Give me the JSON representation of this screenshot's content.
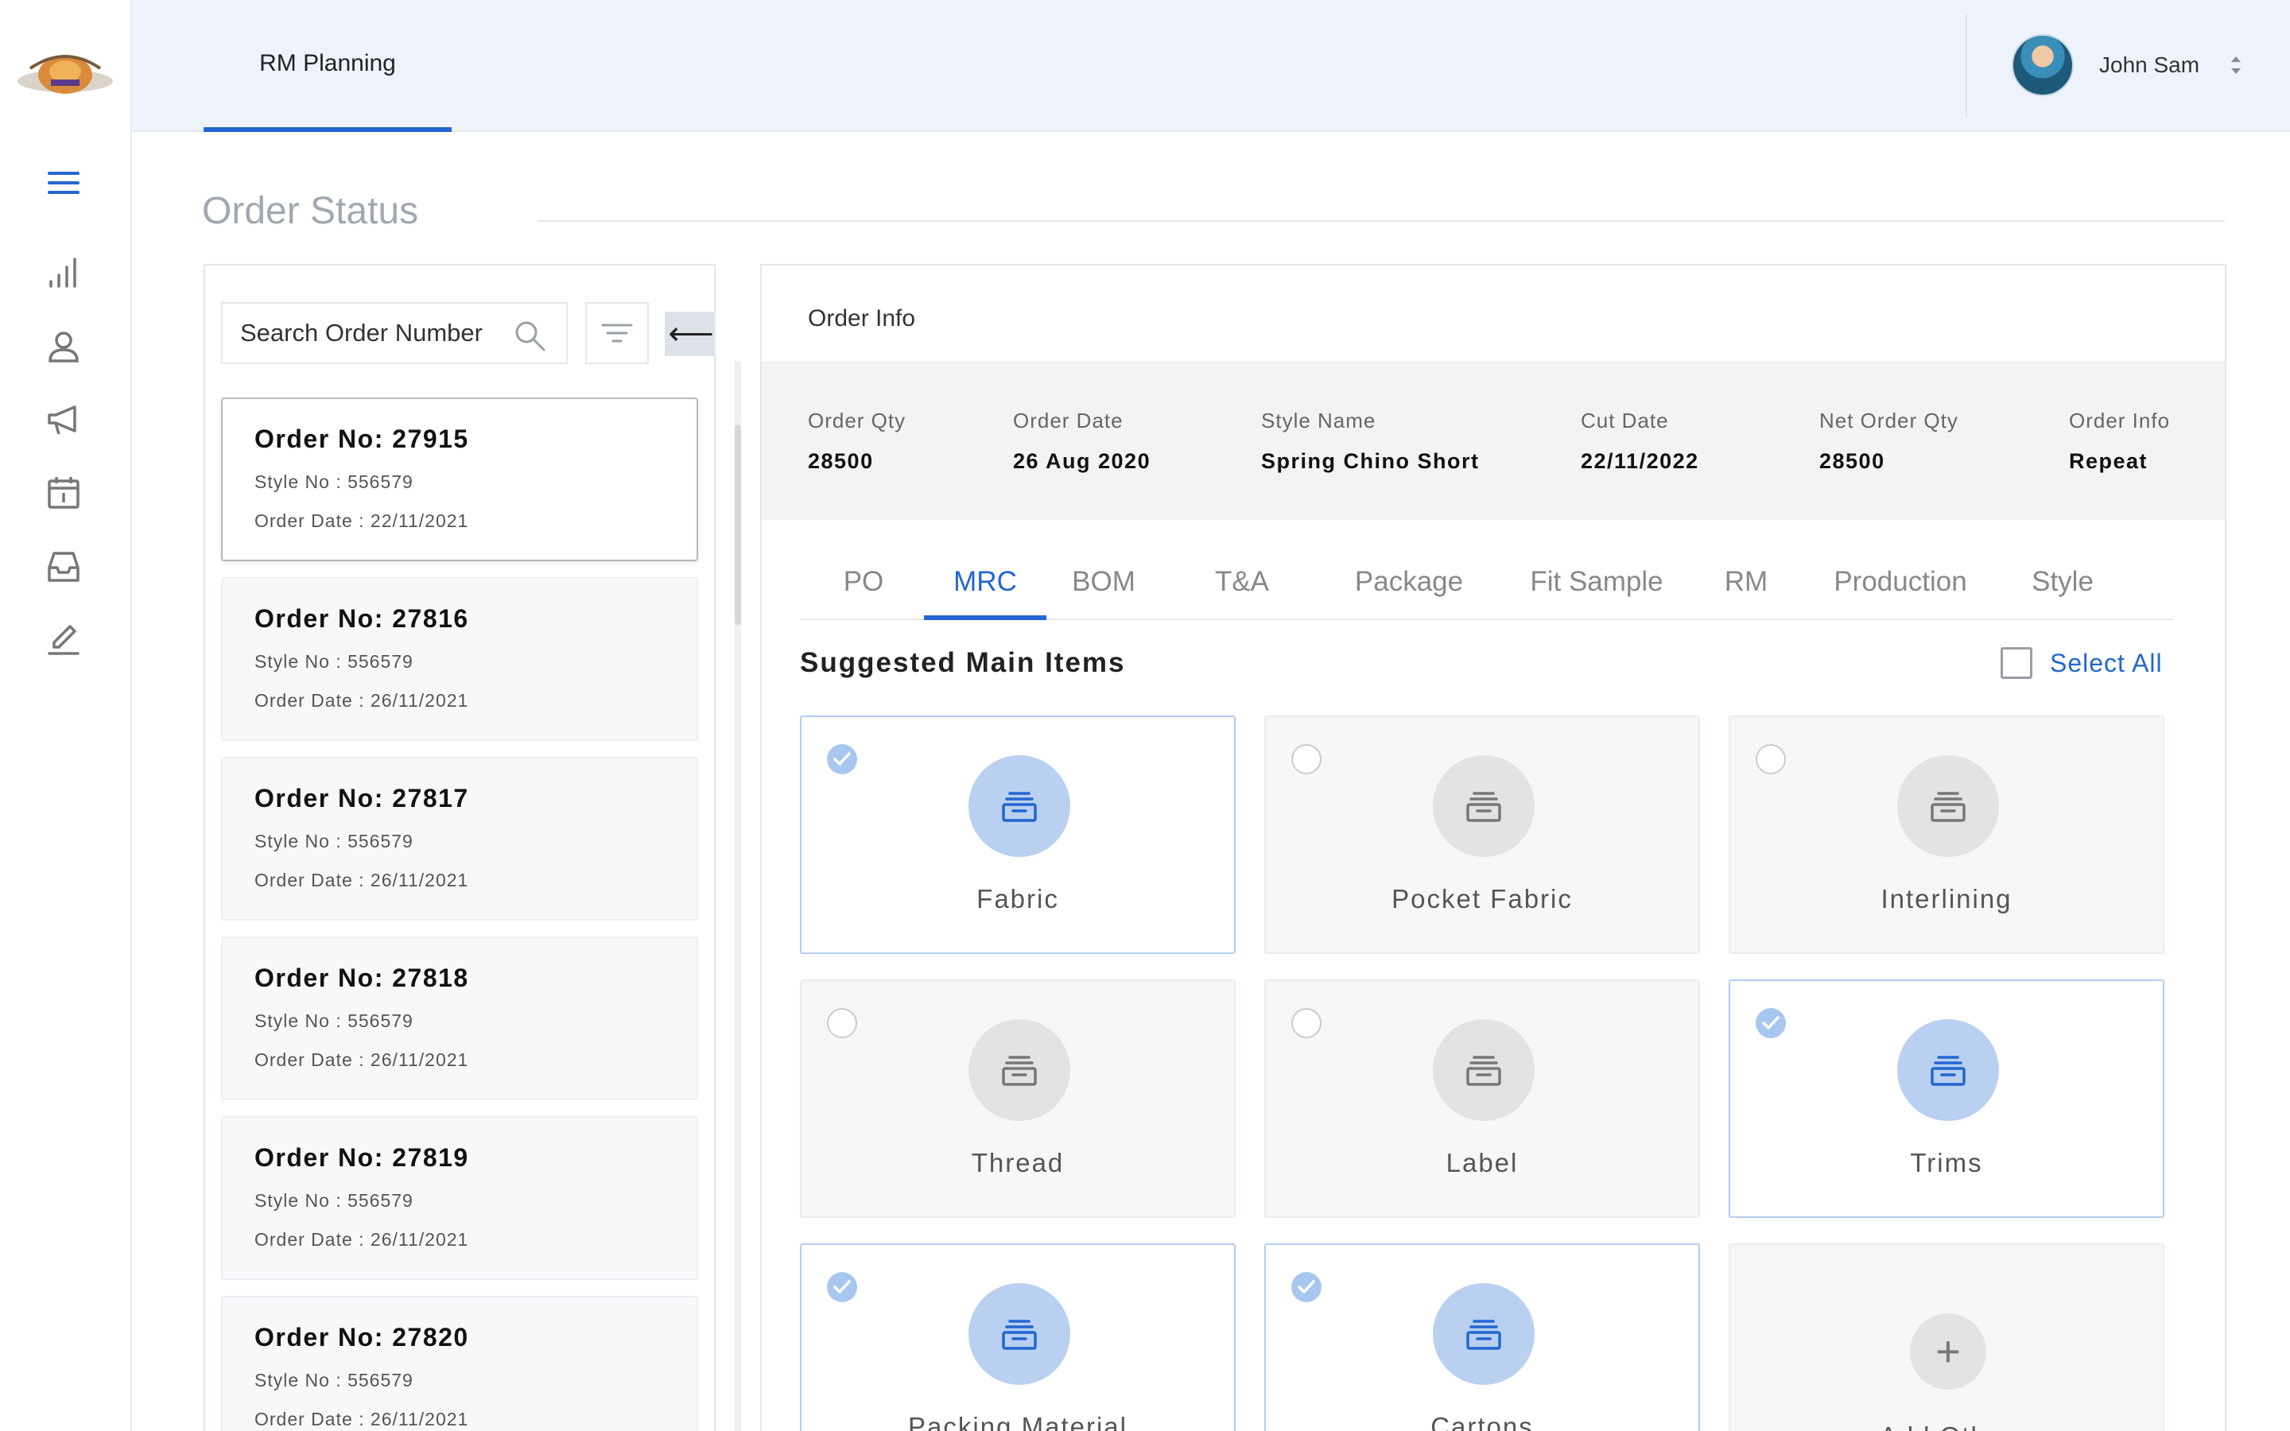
{
  "header": {
    "active_tab": "RM Planning",
    "user_name": "John Sam"
  },
  "sidebar": {
    "icons": [
      "menu-icon",
      "chart-icon",
      "user-icon",
      "megaphone-icon",
      "calendar-icon",
      "inbox-icon",
      "edit-icon"
    ]
  },
  "page": {
    "title": "Order Status"
  },
  "orders": {
    "search_placeholder": "Search Order Number",
    "collapse_label": "⟵",
    "items": [
      {
        "order_no": "Order No: 27915",
        "style_no": "Style No : 556579",
        "order_date": "Order Date : 22/11/2021"
      },
      {
        "order_no": "Order No: 27816",
        "style_no": "Style No : 556579",
        "order_date": "Order Date : 26/11/2021"
      },
      {
        "order_no": "Order No: 27817",
        "style_no": "Style No : 556579",
        "order_date": "Order Date : 26/11/2021"
      },
      {
        "order_no": "Order No: 27818",
        "style_no": "Style No : 556579",
        "order_date": "Order Date : 26/11/2021"
      },
      {
        "order_no": "Order No: 27819",
        "style_no": "Style No : 556579",
        "order_date": "Order Date : 26/11/2021"
      },
      {
        "order_no": "Order No: 27820",
        "style_no": "Style No : 556579",
        "order_date": "Order Date : 26/11/2021"
      }
    ]
  },
  "order_info": {
    "heading": "Order Info",
    "fields": [
      {
        "label": "Order Qty",
        "value": "28500"
      },
      {
        "label": "Order Date",
        "value": "26 Aug 2020"
      },
      {
        "label": "Style Name",
        "value": "Spring Chino Short"
      },
      {
        "label": "Cut Date",
        "value": "22/11/2022"
      },
      {
        "label": "Net Order Qty",
        "value": "28500"
      },
      {
        "label": "Order Info",
        "value": "Repeat"
      }
    ]
  },
  "tabs": [
    "PO",
    "MRC",
    "BOM",
    "T&A",
    "Package",
    "Fit Sample",
    "RM",
    "Production",
    "Style"
  ],
  "active_tab": "MRC",
  "suggested": {
    "title": "Suggested Main Items",
    "select_all": "Select All",
    "items": [
      {
        "label": "Fabric",
        "checked": true
      },
      {
        "label": "Pocket Fabric",
        "checked": false
      },
      {
        "label": "Interlining",
        "checked": false
      },
      {
        "label": "Thread",
        "checked": false
      },
      {
        "label": "Label",
        "checked": false
      },
      {
        "label": "Trims",
        "checked": true
      },
      {
        "label": "Packing Material",
        "checked": true
      },
      {
        "label": "Cartons",
        "checked": true
      }
    ],
    "add_other": "Add Other"
  },
  "colors": {
    "accent": "#2366d1",
    "header_bg": "#eef3fb",
    "checked_border": "#b3cdf0"
  }
}
